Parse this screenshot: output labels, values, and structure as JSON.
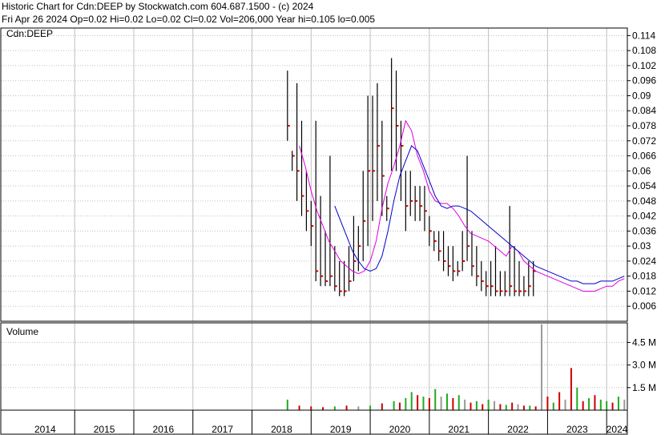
{
  "header": {
    "line1": "Historic Chart for Cdn:DEEP by Stockwatch.com 604.687.1500 - (c) 2024",
    "line2": "Fri Apr 26 2024  Op=0.02  Hi=0.02  Lo=0.02  Cl=0.02  Vol=206,000  Year hi=0.105  lo=0.005"
  },
  "price_panel_label": "Cdn:DEEP",
  "volume_panel_label": "Volume",
  "colors": {
    "bars": "#000000",
    "close_marks": "#cc0000",
    "ma_short": "#dd00dd",
    "ma_long": "#0000cc",
    "vol_up": "#22aa22",
    "vol_down": "#cc0000",
    "vol_flat": "#999999",
    "grid": "#bfbfbf"
  },
  "chart_data": [
    {
      "type": "line",
      "subtype": "ohlc",
      "title": "Cdn:DEEP",
      "ylim": [
        0.0,
        0.117
      ],
      "y_ticks": [
        0.006,
        0.012,
        0.018,
        0.024,
        0.03,
        0.036,
        0.042,
        0.048,
        0.054,
        0.06,
        0.066,
        0.072,
        0.078,
        0.084,
        0.09,
        0.096,
        0.102,
        0.108,
        0.114
      ],
      "y_tick_labels": [
        "0.006",
        "0.012",
        "0.018",
        "0.024",
        "0.03",
        "0.036",
        "0.042",
        "0.048",
        "0.054",
        "0.06",
        "0.066",
        "0.072",
        "0.078",
        "0.084",
        "0.09",
        "0.096",
        "0.102",
        "0.108",
        "0.114"
      ],
      "x_labels": [
        "2014",
        "2015",
        "2016",
        "2017",
        "2018",
        "2019",
        "2020",
        "2021",
        "2022",
        "2023",
        "2024"
      ],
      "grid": true,
      "series": [
        {
          "style": "bars",
          "x": [
            2018.6,
            2018.68,
            2018.76,
            2018.84,
            2018.92,
            2019.0,
            2019.08,
            2019.16,
            2019.24,
            2019.32,
            2019.4,
            2019.48,
            2019.56,
            2019.64,
            2019.72,
            2019.8,
            2019.88,
            2019.96,
            2020.04,
            2020.12,
            2020.2,
            2020.28,
            2020.36,
            2020.44,
            2020.52,
            2020.6,
            2020.68,
            2020.76,
            2020.84,
            2020.92,
            2021.0,
            2021.08,
            2021.16,
            2021.24,
            2021.32,
            2021.4,
            2021.48,
            2021.56,
            2021.64,
            2021.72,
            2021.8,
            2021.88,
            2021.96,
            2022.04,
            2022.12,
            2022.2,
            2022.28,
            2022.36,
            2022.44,
            2022.52,
            2022.6,
            2022.68,
            2022.76,
            2022.84,
            2022.92,
            2023.0,
            2023.08,
            2023.16,
            2023.24,
            2023.32,
            2023.4,
            2023.48,
            2023.56,
            2023.64,
            2023.72,
            2023.8,
            2023.88,
            2023.96,
            2024.04,
            2024.12,
            2024.2,
            2024.28
          ],
          "high": [
            0.1,
            0.068,
            0.095,
            0.08,
            0.06,
            0.048,
            0.08,
            0.05,
            0.036,
            0.066,
            0.03,
            0.024,
            0.024,
            0.03,
            0.042,
            0.038,
            0.06,
            0.09,
            0.09,
            0.095,
            0.08,
            0.05,
            0.105,
            0.1,
            0.08,
            0.06,
            0.06,
            0.054,
            0.054,
            0.054,
            0.042,
            0.036,
            0.036,
            0.036,
            0.03,
            0.03,
            0.024,
            0.036,
            0.066,
            0.036,
            0.03,
            0.024,
            0.02,
            0.024,
            0.03,
            0.02,
            0.02,
            0.046,
            0.03,
            0.024,
            0.018,
            0.024,
            0.024
          ],
          "low": [
            0.072,
            0.06,
            0.048,
            0.042,
            0.036,
            0.03,
            0.016,
            0.014,
            0.014,
            0.014,
            0.012,
            0.01,
            0.01,
            0.012,
            0.016,
            0.02,
            0.024,
            0.03,
            0.04,
            0.048,
            0.042,
            0.04,
            0.06,
            0.06,
            0.048,
            0.036,
            0.042,
            0.04,
            0.04,
            0.036,
            0.03,
            0.028,
            0.024,
            0.02,
            0.018,
            0.016,
            0.018,
            0.02,
            0.024,
            0.018,
            0.014,
            0.012,
            0.01,
            0.01,
            0.01,
            0.01,
            0.01,
            0.01,
            0.01,
            0.01,
            0.01,
            0.01,
            0.01
          ],
          "close": [
            0.078,
            0.066,
            0.06,
            0.05,
            0.044,
            0.038,
            0.02,
            0.018,
            0.016,
            0.018,
            0.014,
            0.012,
            0.012,
            0.016,
            0.024,
            0.03,
            0.04,
            0.06,
            0.06,
            0.07,
            0.058,
            0.045,
            0.085,
            0.078,
            0.07,
            0.046,
            0.048,
            0.048,
            0.046,
            0.044,
            0.036,
            0.032,
            0.028,
            0.024,
            0.022,
            0.02,
            0.02,
            0.024,
            0.03,
            0.022,
            0.018,
            0.016,
            0.014,
            0.014,
            0.012,
            0.012,
            0.012,
            0.014,
            0.012,
            0.012,
            0.012,
            0.014,
            0.02
          ]
        },
        {
          "style": "line",
          "color_key": "ma_short",
          "x": [
            2018.8,
            2018.9,
            2019.0,
            2019.1,
            2019.2,
            2019.3,
            2019.4,
            2019.5,
            2019.6,
            2019.7,
            2019.8,
            2019.9,
            2020.0,
            2020.1,
            2020.2,
            2020.3,
            2020.4,
            2020.5,
            2020.6,
            2020.7,
            2020.8,
            2020.9,
            2021.0,
            2021.1,
            2021.2,
            2021.3,
            2021.4,
            2021.5,
            2021.6,
            2021.7,
            2021.8,
            2021.9,
            2022.0,
            2022.1,
            2022.2,
            2022.3,
            2022.4,
            2022.5,
            2022.6,
            2022.7,
            2022.8,
            2022.9,
            2023.0,
            2023.1,
            2023.2,
            2023.3,
            2023.4,
            2023.5,
            2023.6,
            2023.7,
            2023.8,
            2023.9,
            2024.0,
            2024.1,
            2024.2,
            2024.3
          ],
          "y": [
            0.07,
            0.062,
            0.052,
            0.044,
            0.038,
            0.032,
            0.028,
            0.024,
            0.022,
            0.02,
            0.019,
            0.02,
            0.024,
            0.032,
            0.045,
            0.055,
            0.062,
            0.07,
            0.08,
            0.076,
            0.066,
            0.06,
            0.052,
            0.048,
            0.047,
            0.047,
            0.045,
            0.042,
            0.038,
            0.035,
            0.034,
            0.033,
            0.032,
            0.03,
            0.028,
            0.026,
            0.03,
            0.028,
            0.024,
            0.022,
            0.02,
            0.019,
            0.018,
            0.017,
            0.016,
            0.015,
            0.014,
            0.013,
            0.012,
            0.012,
            0.012,
            0.013,
            0.014,
            0.014,
            0.016,
            0.017
          ]
        },
        {
          "style": "line",
          "color_key": "ma_long",
          "x": [
            2019.4,
            2019.5,
            2019.6,
            2019.7,
            2019.8,
            2019.9,
            2020.0,
            2020.1,
            2020.2,
            2020.3,
            2020.4,
            2020.5,
            2020.6,
            2020.7,
            2020.8,
            2020.9,
            2021.0,
            2021.1,
            2021.2,
            2021.3,
            2021.4,
            2021.5,
            2021.6,
            2021.7,
            2021.8,
            2021.9,
            2022.0,
            2022.1,
            2022.2,
            2022.3,
            2022.4,
            2022.5,
            2022.6,
            2022.7,
            2022.8,
            2022.9,
            2023.0,
            2023.1,
            2023.2,
            2023.3,
            2023.4,
            2023.5,
            2023.6,
            2023.7,
            2023.8,
            2023.9,
            2024.0,
            2024.1,
            2024.2,
            2024.3
          ],
          "y": [
            0.046,
            0.04,
            0.034,
            0.028,
            0.024,
            0.021,
            0.02,
            0.021,
            0.026,
            0.036,
            0.048,
            0.058,
            0.064,
            0.07,
            0.068,
            0.062,
            0.056,
            0.05,
            0.046,
            0.045,
            0.046,
            0.046,
            0.045,
            0.044,
            0.042,
            0.04,
            0.038,
            0.036,
            0.034,
            0.032,
            0.03,
            0.028,
            0.026,
            0.024,
            0.022,
            0.021,
            0.02,
            0.019,
            0.018,
            0.017,
            0.016,
            0.016,
            0.015,
            0.015,
            0.015,
            0.016,
            0.016,
            0.016,
            0.017,
            0.018
          ]
        }
      ]
    },
    {
      "type": "bar",
      "title": "Volume",
      "ylim": [
        0,
        5800000
      ],
      "y_ticks": [
        1500000,
        3000000,
        4500000
      ],
      "y_tick_labels": [
        "1.5 M",
        "3.0 M",
        "4.5 M"
      ],
      "x_labels": [
        "2014",
        "2015",
        "2016",
        "2017",
        "2018",
        "2019",
        "2020",
        "2021",
        "2022",
        "2023",
        "2024"
      ],
      "x": [
        2018.6,
        2018.8,
        2019.0,
        2019.2,
        2019.4,
        2019.6,
        2019.8,
        2020.0,
        2020.2,
        2020.4,
        2020.5,
        2020.6,
        2020.7,
        2020.8,
        2020.9,
        2021.0,
        2021.1,
        2021.2,
        2021.3,
        2021.4,
        2021.5,
        2021.6,
        2021.7,
        2021.8,
        2021.9,
        2022.0,
        2022.1,
        2022.2,
        2022.3,
        2022.4,
        2022.5,
        2022.6,
        2022.7,
        2022.8,
        2022.9,
        2023.0,
        2023.1,
        2023.2,
        2023.3,
        2023.4,
        2023.5,
        2023.6,
        2023.7,
        2023.8,
        2023.9,
        2024.0,
        2024.1,
        2024.2,
        2024.3
      ],
      "values": [
        700000,
        300000,
        250000,
        200000,
        250000,
        300000,
        250000,
        300000,
        450000,
        600000,
        500000,
        800000,
        1200000,
        1000000,
        900000,
        800000,
        1400000,
        900000,
        1100000,
        800000,
        1000000,
        700000,
        500000,
        600000,
        400000,
        700000,
        600000,
        400000,
        350000,
        500000,
        400000,
        300000,
        300000,
        250000,
        5700000,
        900000,
        500000,
        1200000,
        700000,
        2800000,
        1500000,
        600000,
        800000,
        1000000,
        700000,
        600000,
        500000,
        900000,
        700000
      ],
      "direction": [
        "up",
        "down",
        "down",
        "down",
        "up",
        "down",
        "flat",
        "up",
        "down",
        "up",
        "down",
        "up",
        "up",
        "down",
        "up",
        "down",
        "up",
        "flat",
        "up",
        "down",
        "up",
        "flat",
        "down",
        "up",
        "down",
        "up",
        "flat",
        "down",
        "up",
        "down",
        "flat",
        "down",
        "up",
        "down",
        "flat",
        "down",
        "up",
        "down",
        "flat",
        "down",
        "up",
        "down",
        "up",
        "down",
        "up",
        "up",
        "down",
        "up",
        "flat"
      ]
    }
  ]
}
